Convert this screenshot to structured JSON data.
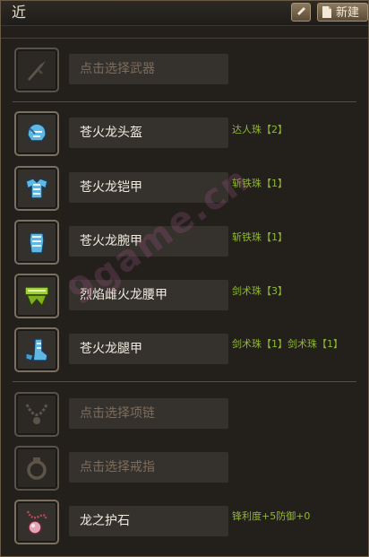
{
  "header": {
    "title": "近",
    "edit_icon": "pencil-icon",
    "new_label": "新建",
    "new_icon": "document-icon"
  },
  "slots": [
    {
      "label": "点击选择武器",
      "empty": true,
      "icon": "weapon-icon",
      "decorations": []
    },
    {
      "label": "苍火龙头盔",
      "empty": false,
      "icon": "helmet-icon",
      "decorations": [
        "达人珠【2】"
      ]
    },
    {
      "label": "苍火龙铠甲",
      "empty": false,
      "icon": "chest-armor-icon",
      "decorations": [
        "斩铁珠【1】"
      ]
    },
    {
      "label": "苍火龙腕甲",
      "empty": false,
      "icon": "gauntlet-icon",
      "decorations": [
        "斩铁珠【1】"
      ]
    },
    {
      "label": "烈焰雌火龙腰甲",
      "empty": false,
      "icon": "waist-armor-icon",
      "decorations": [
        "剑术珠【3】"
      ]
    },
    {
      "label": "苍火龙腿甲",
      "empty": false,
      "icon": "leg-armor-icon",
      "decorations": [
        "剑术珠【1】剑术珠【1】"
      ]
    },
    {
      "label": "点击选择项链",
      "empty": true,
      "icon": "necklace-icon",
      "decorations": []
    },
    {
      "label": "点击选择戒指",
      "empty": true,
      "icon": "ring-icon",
      "decorations": []
    },
    {
      "label": "龙之护石",
      "empty": false,
      "icon": "charm-icon",
      "decorations": [
        "锋利度+5防御+0"
      ]
    }
  ],
  "watermark": "9game.cn",
  "colors": {
    "decoration_text": "#8fb833",
    "empty_label": "#7d6d5d",
    "filled_label": "#f1ebe0",
    "button_bg": "#7a6a50"
  }
}
